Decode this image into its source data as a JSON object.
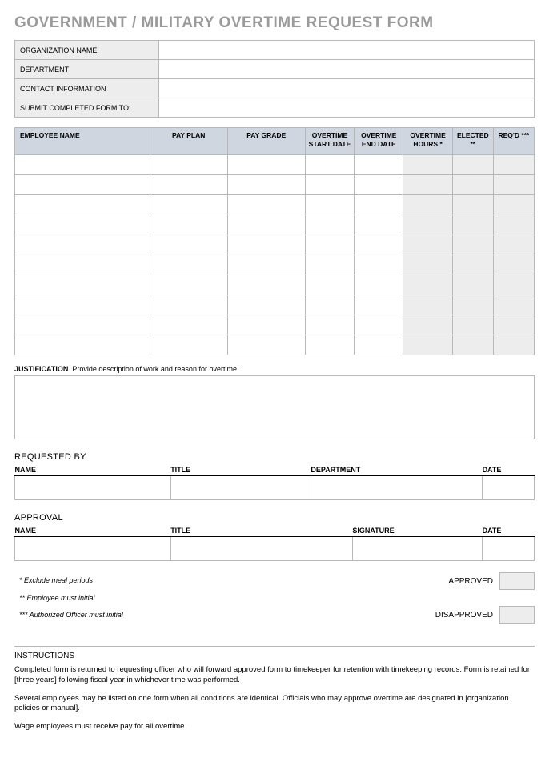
{
  "title": "GOVERNMENT / MILITARY OVERTIME REQUEST FORM",
  "orgFields": {
    "orgName": "ORGANIZATION NAME",
    "department": "DEPARTMENT",
    "contact": "CONTACT INFORMATION",
    "submitTo": "SUBMIT COMPLETED FORM TO:"
  },
  "empHeaders": {
    "name": "EMPLOYEE NAME",
    "payPlan": "PAY PLAN",
    "payGrade": "PAY GRADE",
    "start": "OVERTIME START DATE",
    "end": "OVERTIME END DATE",
    "hours": "OVERTIME HOURS *",
    "elected": "ELECTED **",
    "reqd": "REQ'D ***"
  },
  "justification": {
    "label": "JUSTIFICATION",
    "hint": "Provide description of work and reason for overtime."
  },
  "requested": {
    "title": "REQUESTED BY",
    "cols": {
      "name": "NAME",
      "title": "TITLE",
      "dept": "DEPARTMENT",
      "date": "DATE"
    }
  },
  "approval": {
    "title": "APPROVAL",
    "cols": {
      "name": "NAME",
      "title": "TITLE",
      "sig": "SIGNATURE",
      "date": "DATE"
    }
  },
  "footnotes": {
    "f1": "* Exclude meal periods",
    "f2": "** Employee must initial",
    "f3": "*** Authorized Officer must initial"
  },
  "status": {
    "approved": "APPROVED",
    "disapproved": "DISAPPROVED"
  },
  "instructions": {
    "title": "INSTRUCTIONS",
    "p1": "Completed form is returned to requesting officer who will forward approved form to timekeeper for retention with timekeeping records. Form is retained for [three years] following fiscal year in whichever time was performed.",
    "p2": "Several employees may be listed on one form when all conditions are identical. Officials who may approve overtime are designated in [organization policies or manual].",
    "p3": "Wage employees must receive pay for all overtime."
  }
}
